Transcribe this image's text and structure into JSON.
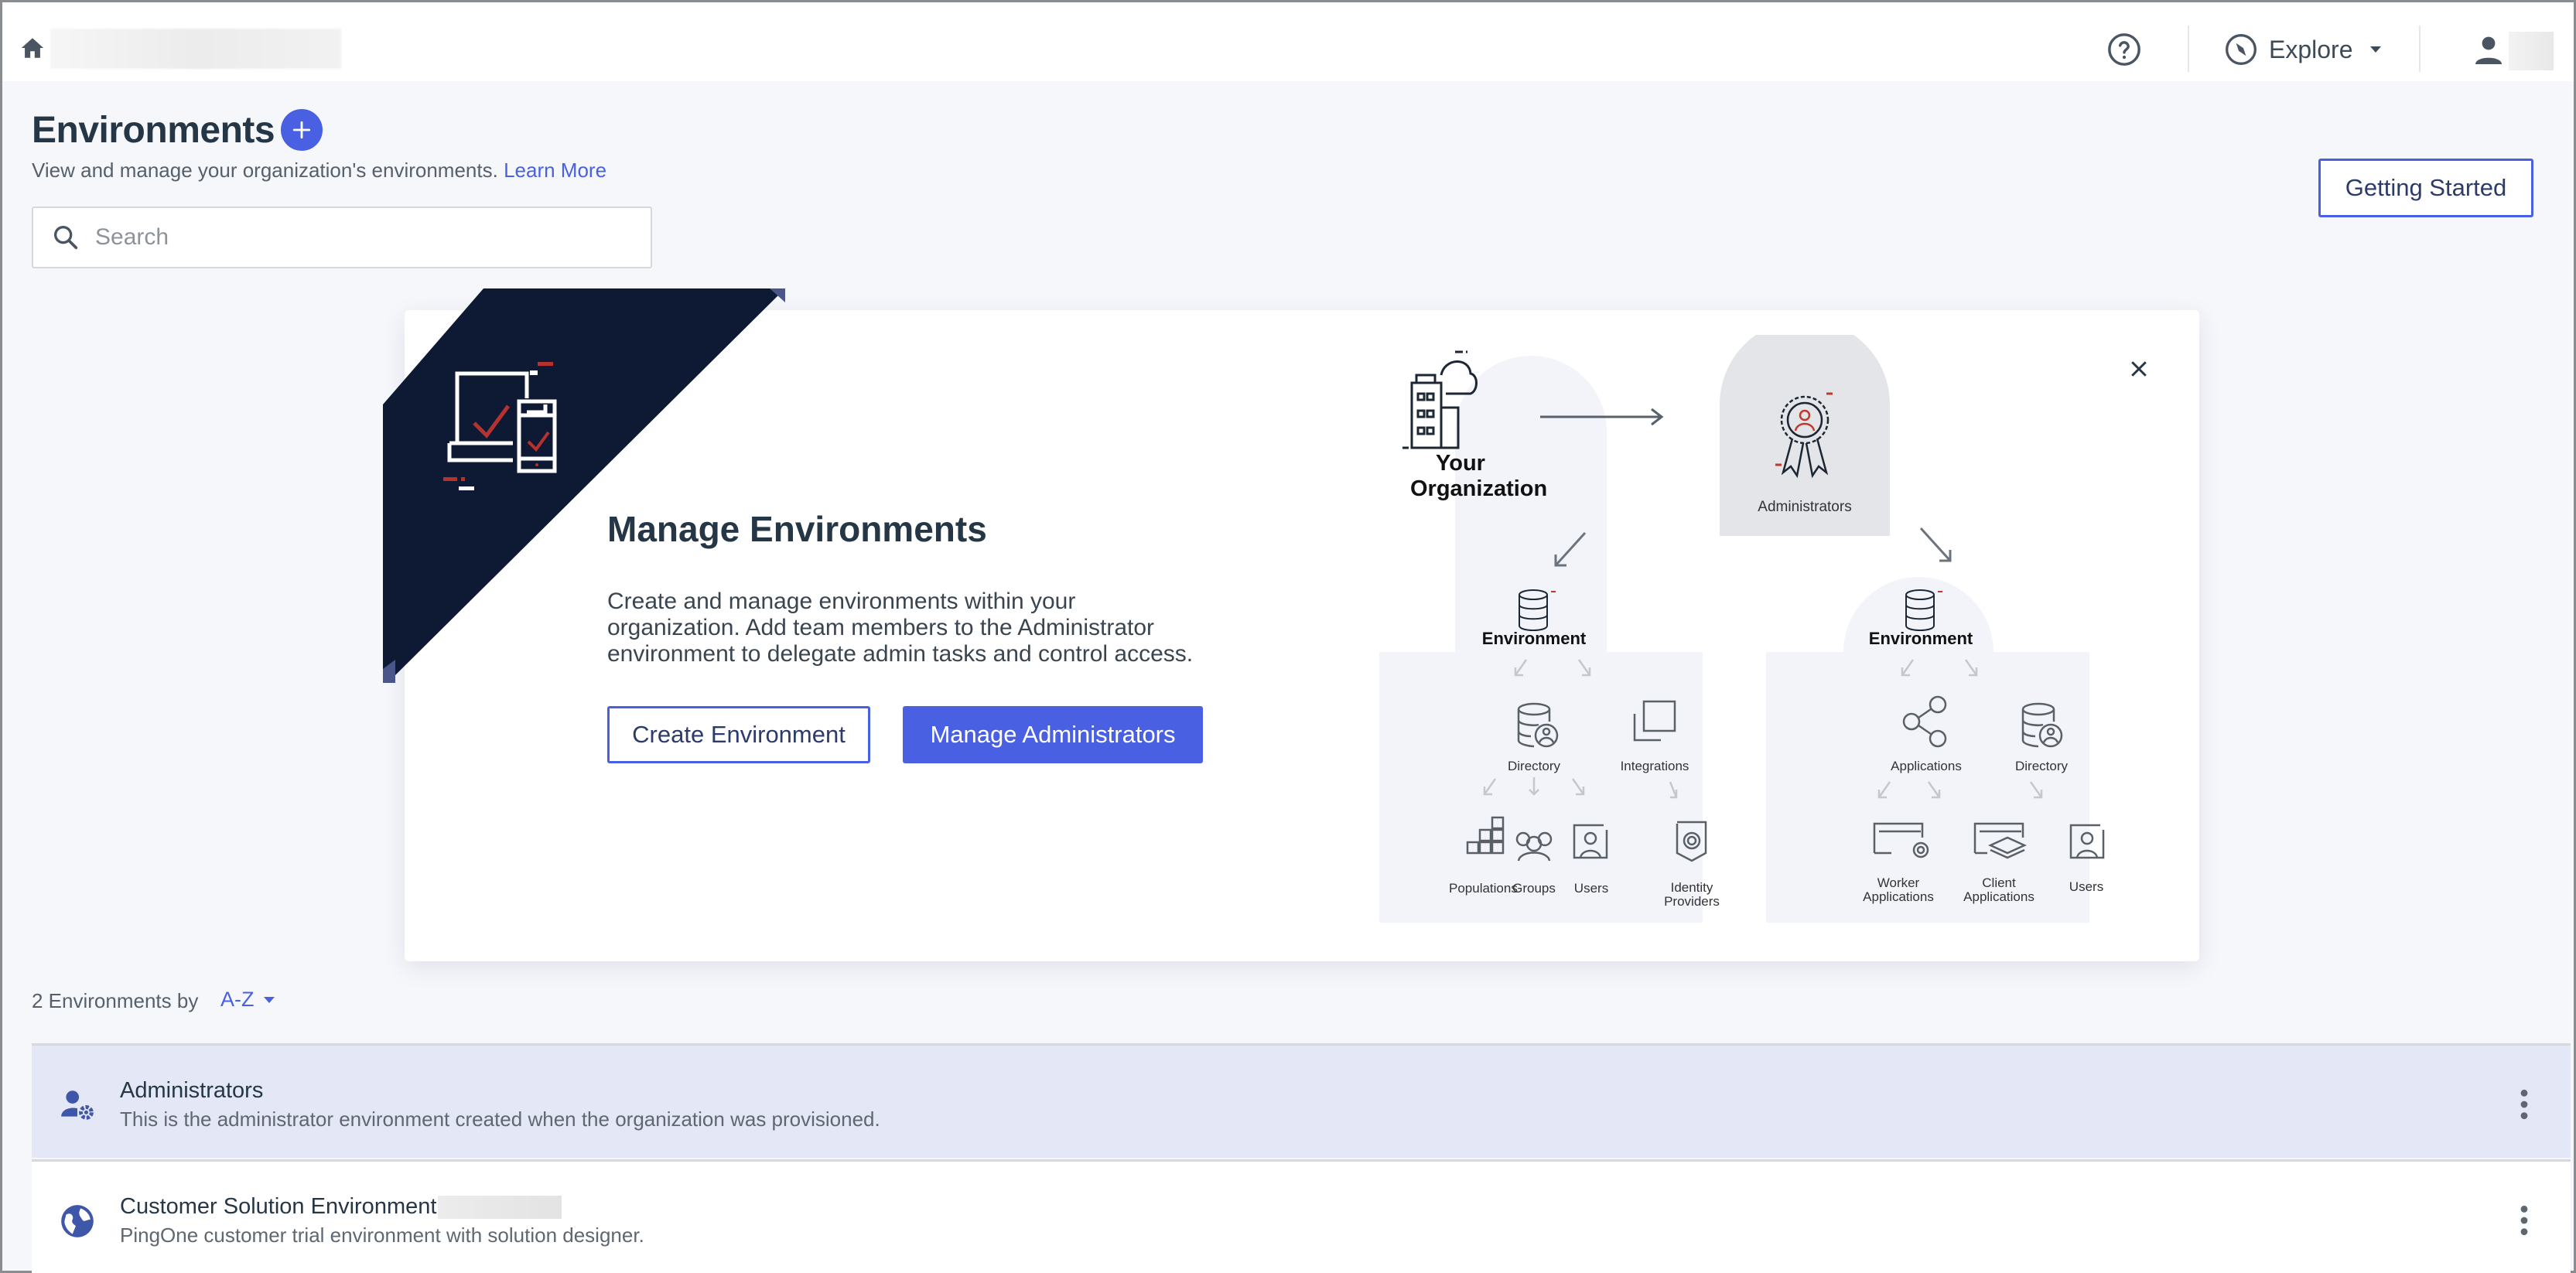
{
  "topbar": {
    "home_icon": "home-icon",
    "help_icon": "help-circle-icon",
    "explore_label": "Explore",
    "explore_icon": "compass-icon",
    "user_icon": "user-icon"
  },
  "header": {
    "title": "Environments",
    "add_icon": "plus-icon",
    "subtitle": "View and manage your organization's environments.",
    "learn_more": "Learn More",
    "search_placeholder": "Search",
    "search_value": "",
    "getting_started": "Getting Started"
  },
  "welcome_card": {
    "title": "Manage Environments",
    "description": "Create and manage environments within your organization. Add team members to the Administrator environment to delegate admin tasks and control access.",
    "create_button": "Create Environment",
    "manage_button": "Manage Administrators",
    "close_icon": "close-icon",
    "colors": {
      "banner": "#0e1a33",
      "accent_red": "#b5322f",
      "primary": "#4a60e2"
    },
    "diagram": {
      "organization_label_line1": "Your",
      "organization_label_line2": "Organization",
      "administrators_label": "Administrators",
      "left_env": {
        "title": "Environment",
        "children": [
          "Directory",
          "Integrations"
        ],
        "grandchildren": [
          "Populations",
          "Groups",
          "Users"
        ],
        "identity_line1": "Identity",
        "identity_line2": "Providers"
      },
      "right_env": {
        "title": "Environment",
        "children": [
          "Applications",
          "Directory"
        ],
        "worker_line1": "Worker",
        "worker_line2": "Applications",
        "client_line1": "Client",
        "client_line2": "Applications",
        "users": "Users"
      }
    }
  },
  "listing": {
    "count_label": "2 Environments by",
    "sort_value": "A-Z",
    "environments": [
      {
        "name": "Administrators",
        "description": "This is the administrator environment created when the organization was provisioned.",
        "icon": "user-gear-icon",
        "selected": true
      },
      {
        "name": "Customer Solution Environment",
        "description": "PingOne customer trial environment with solution designer.",
        "icon": "globe-icon",
        "selected": false
      }
    ]
  }
}
